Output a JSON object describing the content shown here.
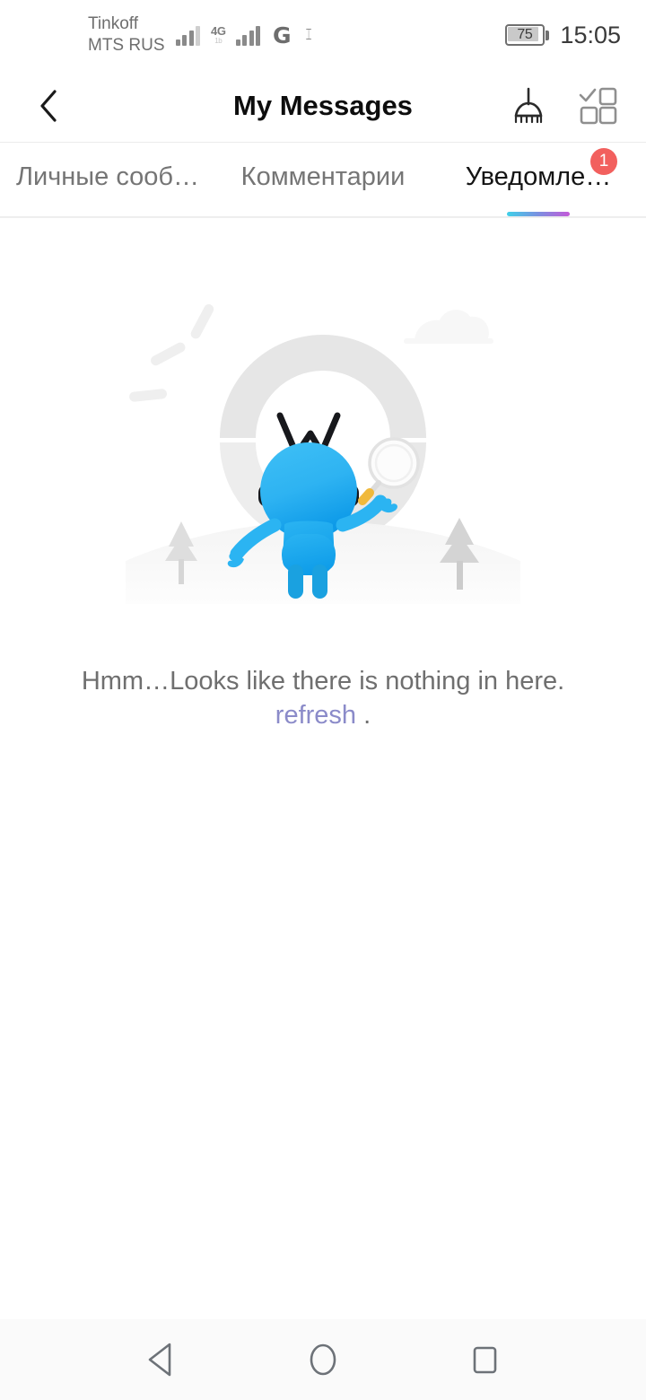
{
  "status_bar": {
    "carrier_line1": "Tinkoff",
    "carrier_line2": "MTS RUS",
    "network_type": "4G",
    "network_sub": "1b",
    "signal_icon": "signal-bars-icon",
    "signal_icon_2": "signal-bars-icon",
    "g_icon": "g-network-icon",
    "sim_icon": "sim-card-icon",
    "battery_level": "75",
    "battery_icon": "battery-icon",
    "time": "15:05"
  },
  "app_bar": {
    "back_icon": "back-chevron-icon",
    "title": "My Messages",
    "clear_icon": "broom-icon",
    "select_icon": "multi-select-grid-icon"
  },
  "tabs": {
    "items": [
      {
        "label": "Личные сооб…",
        "active": false,
        "badge": ""
      },
      {
        "label": "Комментарии",
        "active": false,
        "badge": ""
      },
      {
        "label": "Уведомле…",
        "active": true,
        "badge": "1"
      }
    ],
    "underline_gradient_from": "#3fd0e8",
    "underline_gradient_to": "#c45ad8",
    "badge_color": "#f2605e",
    "active_color": "#141414",
    "inactive_color": "#757575"
  },
  "empty_state": {
    "illustration_name": "robot-with-magnifier-illustration",
    "message": "Hmm…Looks like there is nothing in here.",
    "refresh_label": "refresh",
    "trailing_punctuation": ".",
    "link_color": "#8b8bc9",
    "text_color": "#6f6f6f",
    "mascot_color": "#17a7f0",
    "ring_color": "#e4e4e4"
  },
  "nav_bar": {
    "back_icon": "nav-back-triangle-icon",
    "home_icon": "nav-home-circle-icon",
    "recents_icon": "nav-recents-square-icon",
    "background": "#fafafa"
  }
}
